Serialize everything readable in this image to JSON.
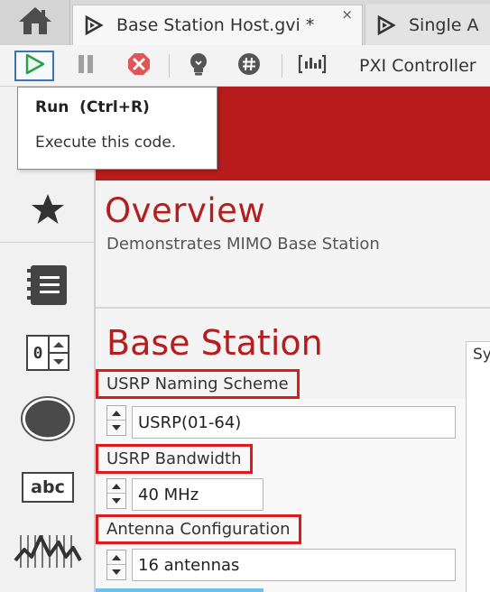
{
  "tabs": [
    {
      "label": "Base Station Host.gvi *",
      "active": true,
      "close_glyph": "×"
    },
    {
      "label": "Single A",
      "active": false
    }
  ],
  "toolbar": {
    "run_icon": "play-icon",
    "pause_icon": "pause-icon",
    "abort_icon": "abort-icon",
    "highlight_icon": "lightbulb-icon",
    "retain_icon": "hash-icon",
    "probe_icon": "probe-icon",
    "target_label": "PXI Controller"
  },
  "tooltip": {
    "title": "Run  (Ctrl+R)",
    "description": "Execute this code."
  },
  "palette": {
    "items": [
      "star-icon",
      "notebook-icon",
      "numeric-control-icon",
      "led-icon",
      "string-control-icon",
      "graph-icon"
    ],
    "numeric_glyph": "0",
    "string_glyph": "abc"
  },
  "canvas": {
    "overview_title": "Overview",
    "overview_description": "Demonstrates MIMO Base Station",
    "section_title": "Base Station",
    "system_panel_label": "Sy",
    "fields": [
      {
        "label": "USRP Naming Scheme",
        "value": "USRP(01-64)"
      },
      {
        "label": "USRP Bandwidth",
        "value": "40 MHz"
      },
      {
        "label": "Antenna Configuration",
        "value": "16 antennas"
      }
    ]
  },
  "colors": {
    "brand_red": "#b81c1c",
    "title_red": "#b41e1e",
    "highlight_box": "#e0191c",
    "run_button_border": "#3b74b7",
    "run_green": "#2e9f49"
  }
}
